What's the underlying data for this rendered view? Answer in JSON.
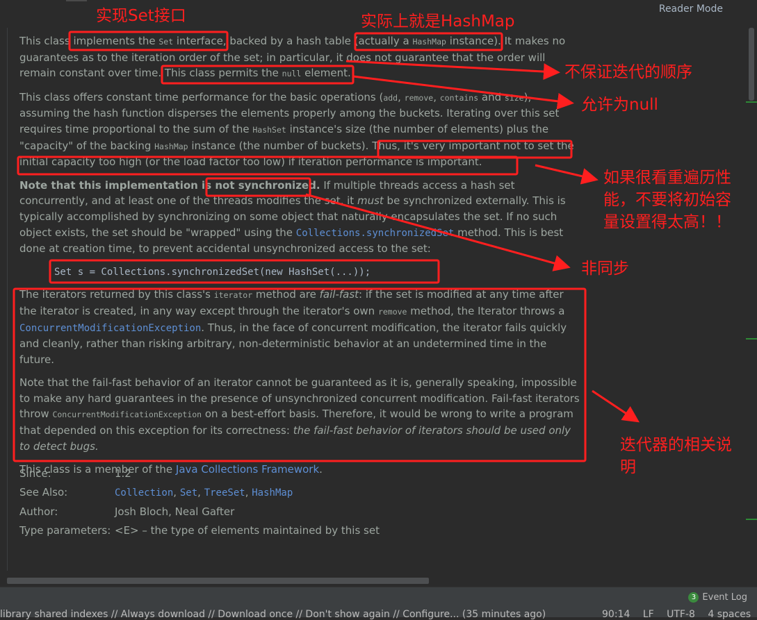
{
  "header": {
    "reader_mode": "Reader Mode"
  },
  "doc": {
    "p1": {
      "t1": "This class ",
      "t2": "implements the ",
      "t3": "Set",
      "t4": " interface, backed by a hash table (actually a ",
      "t5": "HashMap",
      "t6": " instance). It makes no guarantees as to the iteration order of the set; in particular, it does not guarantee that the order will remain constant over time. This class permits the ",
      "t7": "null",
      "t8": " element."
    },
    "p2": {
      "t1": "This class offers constant time performance for the basic operations (",
      "t2": "add",
      "t3": ", ",
      "t4": "remove",
      "t5": ", ",
      "t6": "contains",
      "t7": " and ",
      "t8": "size",
      "t9": "), assuming the hash function disperses the elements properly among the buckets. Iterating over this set requires time proportional to the sum of the ",
      "t10": "HashSet",
      "t11": " instance's size (the number of elements) plus the \"capacity\" of the backing ",
      "t12": "HashMap",
      "t13": " instance (the number of buckets). Thus, it's very important not to set the initial capacity too high (or the load factor too low) if iteration performance is important."
    },
    "p3": {
      "t1": "Note that this implementation is not synchronized.",
      "t2": " If multiple threads access a hash set concurrently, and at least one of the threads modifies the set, it ",
      "t3": "must",
      "t4": " be synchronized externally. This is typically accomplished by synchronizing on some object that naturally encapsulates the set. If no such object exists, the set should be \"wrapped\" using the ",
      "t5": "Collections.synchronizedSet",
      "t6": " method. This is best done at creation time, to prevent accidental unsynchronized access to the set:"
    },
    "code": "Set s = Collections.synchronizedSet(new HashSet(...));",
    "p4": {
      "t1": "The iterators returned by this class's ",
      "t2": "iterator",
      "t3": " method are ",
      "t4": "fail-fast",
      "t5": ": if the set is modified at any time after the iterator is created, in any way except through the iterator's own ",
      "t6": "remove",
      "t7": " method, the Iterator throws a ",
      "t8": "ConcurrentModificationException",
      "t9": ". Thus, in the face of concurrent modification, the iterator fails quickly and cleanly, rather than risking arbitrary, non-deterministic behavior at an undetermined time in the future."
    },
    "p5": {
      "t1": "Note that the fail-fast behavior of an iterator cannot be guaranteed as it is, generally speaking, impossible to make any hard guarantees in the presence of unsynchronized concurrent modification. Fail-fast iterators throw ",
      "t2": "ConcurrentModificationException",
      "t3": " on a best-effort basis. Therefore, it would be wrong to write a program that depended on this exception for its correctness: ",
      "t4": "the fail-fast behavior of iterators should be used only to detect bugs."
    },
    "p6": {
      "t1": "This class is a member of the ",
      "t2": "Java Collections Framework",
      "t3": "."
    }
  },
  "meta": {
    "since_label": "Since:",
    "since_value": "1.2",
    "see_label": "See Also:",
    "see": [
      "Collection",
      "Set",
      "TreeSet",
      "HashMap"
    ],
    "sep": ", ",
    "author_label": "Author:",
    "author_value": "Josh Bloch, Neal Gafter",
    "type_label": "Type parameters:",
    "type_value": "<E> – the type of elements maintained by this set"
  },
  "annotations": {
    "a1": "实现Set接口",
    "a2": "实际上就是HashMap",
    "a3": "不保证迭代的顺序",
    "a4": "允许为null",
    "a5_l1": "如果很看重遍历性",
    "a5_l2": "能，不要将初始容",
    "a5_l3": "量设置得太高！！",
    "a6": "非同步",
    "a7_l1": "迭代器的相关说",
    "a7_l2": "明"
  },
  "statusbar": {
    "event_count": "3",
    "event_log": "Event Log",
    "message": "library shared indexes // Always download // Download once // Don't show again // Configure... (35 minutes ago)",
    "position": "90:14",
    "line_sep": "LF",
    "encoding": "UTF-8",
    "indent": "4 spaces"
  },
  "colors": {
    "annotation": "#ff1f1f",
    "link": "#5e8fd4",
    "text": "#9da6a0"
  }
}
